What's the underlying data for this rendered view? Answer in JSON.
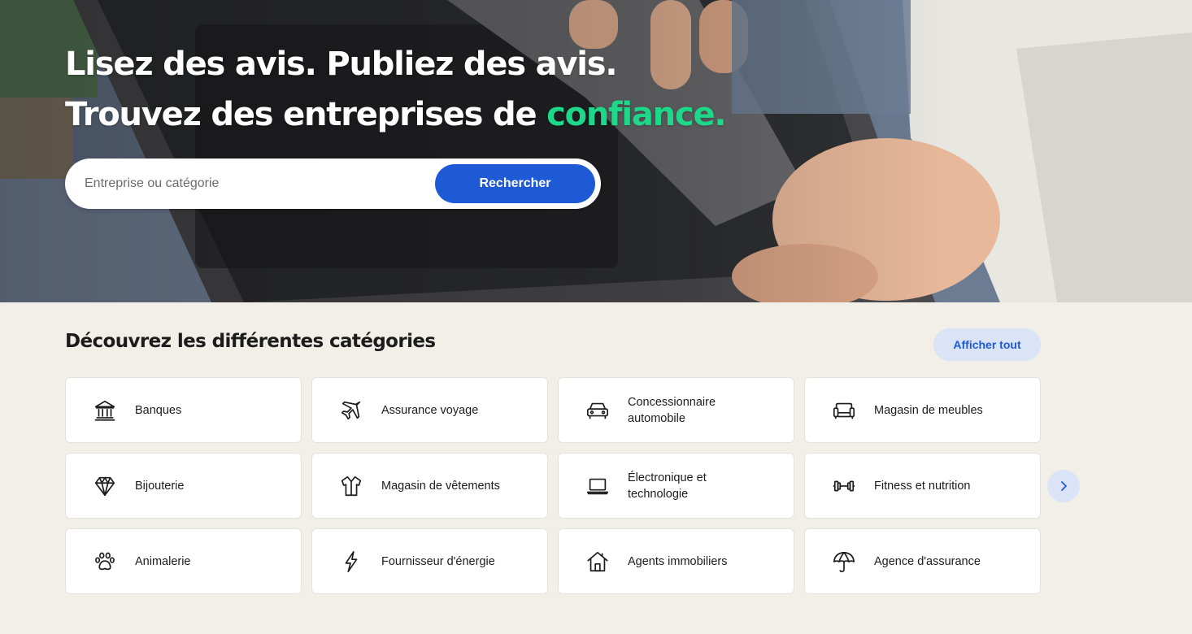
{
  "hero": {
    "title_line1": "Lisez des avis. Publiez des avis.",
    "title_line2_prefix": "Trouvez des entreprises de ",
    "title_line2_accent": "confiance.",
    "search": {
      "placeholder": "Entreprise ou catégorie",
      "value": "",
      "button_label": "Rechercher"
    }
  },
  "categories": {
    "title": "Découvrez les différentes catégories",
    "show_all_label": "Afficher tout",
    "next_icon": "chevron-right-icon",
    "items": [
      {
        "label": "Banques",
        "icon": "bank-icon"
      },
      {
        "label": "Assurance voyage",
        "icon": "airplane-icon"
      },
      {
        "label": "Concessionnaire automobile",
        "icon": "car-icon"
      },
      {
        "label": "Magasin de meubles",
        "icon": "sofa-icon"
      },
      {
        "label": "Bijouterie",
        "icon": "diamond-icon"
      },
      {
        "label": "Magasin de vêtements",
        "icon": "shirt-icon"
      },
      {
        "label": "Électronique et technologie",
        "icon": "laptop-icon"
      },
      {
        "label": "Fitness et nutrition",
        "icon": "dumbbell-icon"
      },
      {
        "label": "Animalerie",
        "icon": "paw-icon"
      },
      {
        "label": "Fournisseur d'énergie",
        "icon": "lightning-icon"
      },
      {
        "label": "Agents immobiliers",
        "icon": "house-icon"
      },
      {
        "label": "Agence d'assurance",
        "icon": "umbrella-icon"
      }
    ]
  },
  "colors": {
    "accent_green": "#1ed88a",
    "primary_blue": "#1f5ad6",
    "light_blue": "#dbe3f7",
    "page_background": "#f1efe8"
  }
}
